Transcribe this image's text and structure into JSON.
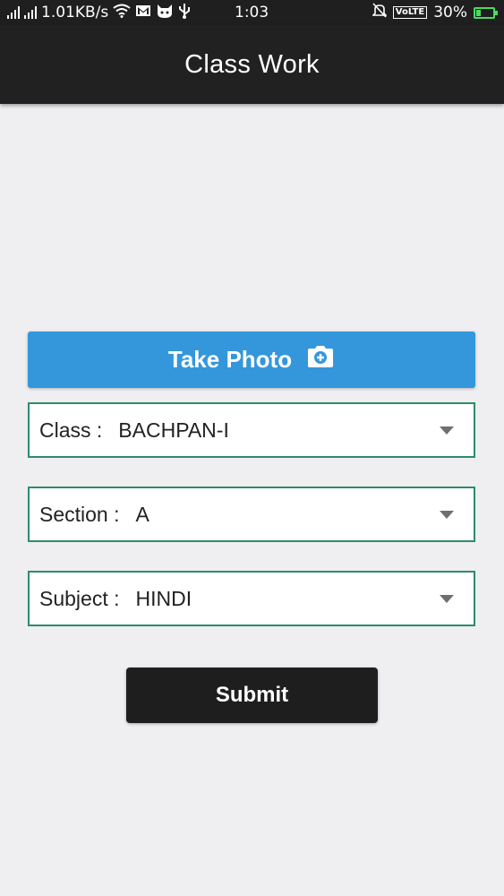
{
  "status_bar": {
    "network_speed": "1.01KB/s",
    "time": "1:03",
    "volte": "VoLTE",
    "battery_percent": "30%",
    "battery_level": 0.3,
    "icons": [
      "signal-icon",
      "signal-icon",
      "wifi-icon",
      "gmail-icon",
      "cat-app-icon",
      "usb-icon",
      "silent-bell-icon",
      "volte-icon",
      "battery-charging-icon"
    ]
  },
  "toolbar": {
    "title": "Class Work"
  },
  "photo_button": {
    "label": "Take Photo",
    "icon": "camera-icon",
    "color": "#3497dc"
  },
  "form": {
    "class": {
      "label": "Class :",
      "value": "BACHPAN-I"
    },
    "section": {
      "label": "Section :",
      "value": "A"
    },
    "subject": {
      "label": "Subject :",
      "value": "HINDI"
    },
    "border_color": "#2e8b6b"
  },
  "submit": {
    "label": "Submit",
    "color": "#1e1e1e"
  }
}
